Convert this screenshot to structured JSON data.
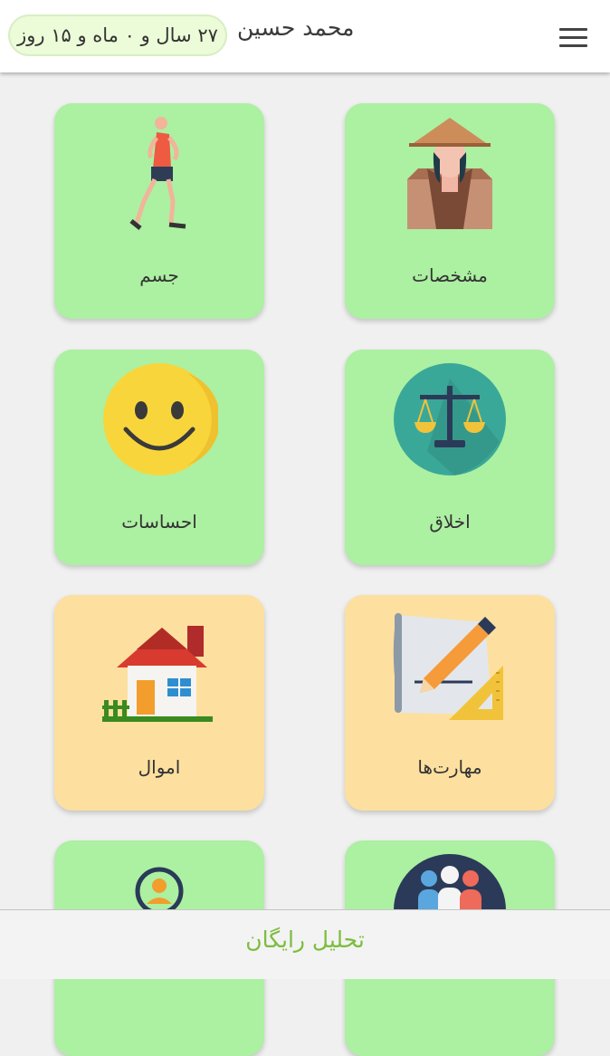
{
  "header": {
    "menu_icon": "hamburger-menu-icon",
    "user_name": "محمد حسین",
    "age": "۲۷ سال و ۰ ماه و ۱۵ روز"
  },
  "tiles": [
    {
      "label": "مشخصات",
      "icon": "person-with-hat-icon",
      "color": "#acf0a2"
    },
    {
      "label": "جسم",
      "icon": "running-man-icon",
      "color": "#acf0a2"
    },
    {
      "label": "اخلاق",
      "icon": "scales-of-justice-icon",
      "color": "#acf0a2"
    },
    {
      "label": "احساسات",
      "icon": "smiley-face-icon",
      "color": "#acf0a2"
    },
    {
      "label": "مهارت‌ها",
      "icon": "drafting-pencil-ruler-icon",
      "color": "#fddf9f"
    },
    {
      "label": "اموال",
      "icon": "house-icon",
      "color": "#fddf9f"
    },
    {
      "label": "",
      "icon": "people-group-icon",
      "color": "#acf0a2"
    },
    {
      "label": "",
      "icon": "person-search-icon",
      "color": "#acf0a2"
    }
  ],
  "footer": {
    "action_label": "تحلیل رایگان",
    "action_color": "#7cbd3d"
  }
}
